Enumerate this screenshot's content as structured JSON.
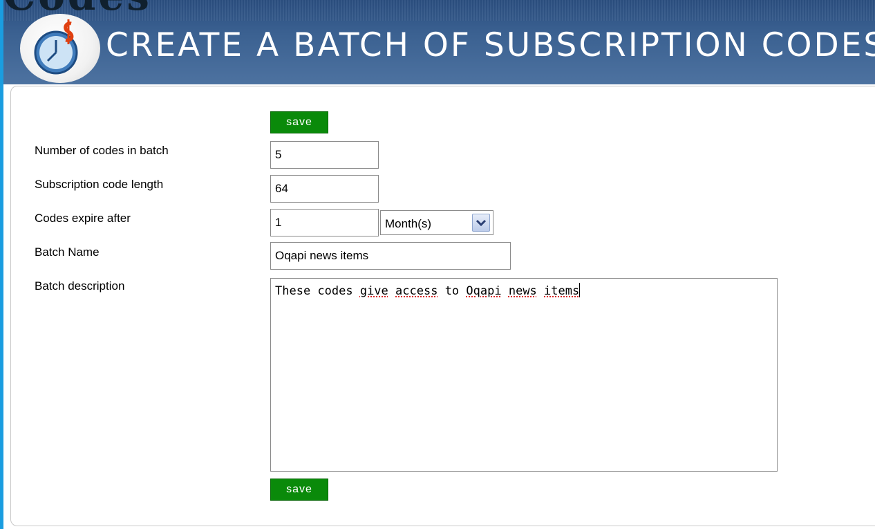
{
  "header": {
    "title": "CREATE A BATCH OF SUBSCRIPTION CODES",
    "clipped_text": "Codes",
    "logo": "clock-dollar-logo-icon",
    "bg_color": "#3b6191"
  },
  "form": {
    "save_label": "save",
    "fields": {
      "num_codes": {
        "label": "Number of codes in batch",
        "value": "5"
      },
      "code_length": {
        "label": "Subscription code length",
        "value": "64"
      },
      "expire": {
        "label": "Codes expire after",
        "value": "1",
        "unit": "Month(s)"
      },
      "batch_name": {
        "label": "Batch Name",
        "value": "Oqapi news items"
      },
      "batch_description": {
        "label": "Batch description",
        "value": "These codes give access to Oqapi news items",
        "parts": [
          "These codes ",
          "give",
          " ",
          "access",
          " to ",
          "Oqapi",
          " ",
          "news",
          " ",
          "items"
        ]
      }
    },
    "button_color": "#0a8a0a"
  }
}
